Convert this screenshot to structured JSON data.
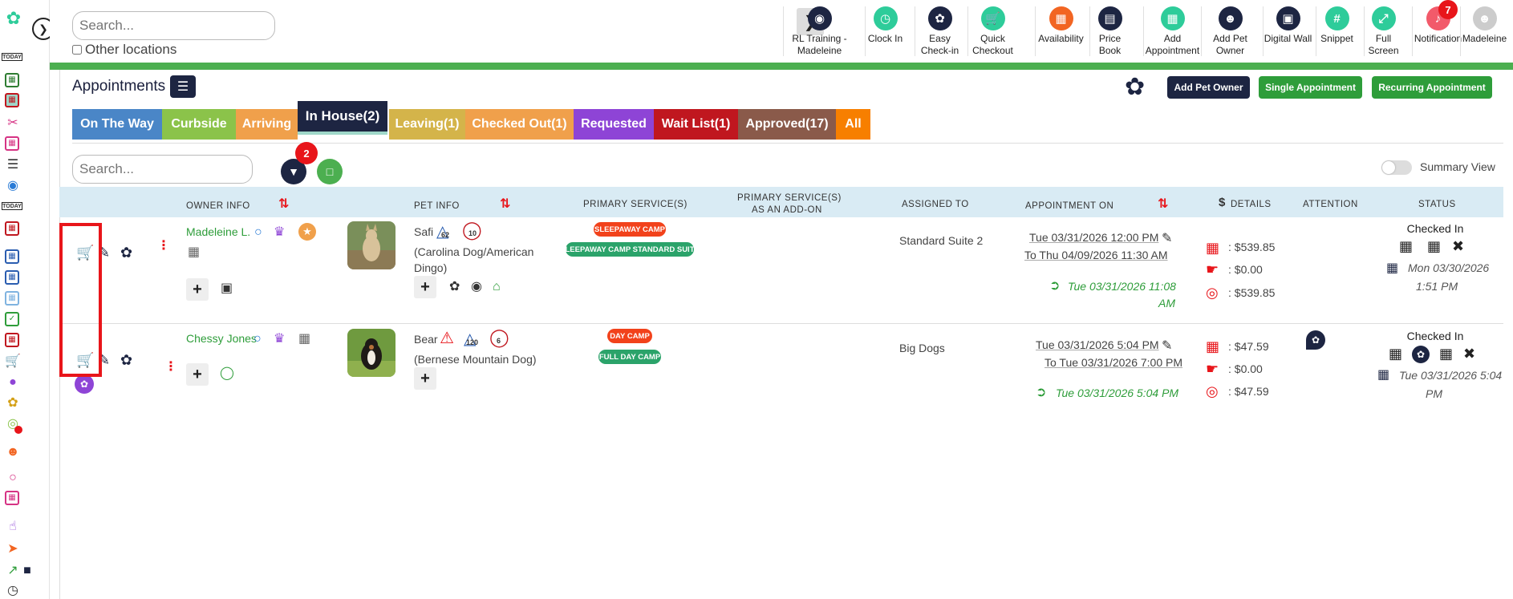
{
  "header": {
    "search_placeholder": "Search...",
    "other_locations_label": "Other locations",
    "tools": [
      {
        "label": "RL Training - Madeleine",
        "color": "#1d2542",
        "icon": "map-pin-icon"
      },
      {
        "label": "Clock In",
        "color": "#2ecc9a",
        "icon": "clock-icon"
      },
      {
        "label": "Easy Check-in",
        "color": "#1d2542",
        "icon": "paw-icon"
      },
      {
        "label": "Quick Checkout",
        "color": "#2ecc9a",
        "icon": "cart-icon"
      },
      {
        "label": "Availability",
        "color": "#f26522",
        "icon": "calendar-icon"
      },
      {
        "label": "Price Book",
        "color": "#1d2542",
        "icon": "book-icon"
      },
      {
        "label": "Add Appointment",
        "color": "#2ecc9a",
        "icon": "calendar-plus-icon"
      },
      {
        "label": "Add Pet Owner",
        "color": "#1d2542",
        "icon": "user-plus-icon"
      },
      {
        "label": "Digital Wall",
        "color": "#1d2542",
        "icon": "monitor-icon"
      },
      {
        "label": "Snippet",
        "color": "#2ecc9a",
        "icon": "hash-icon"
      },
      {
        "label": "Full Screen",
        "color": "#2ecc9a",
        "icon": "expand-icon"
      },
      {
        "label": "Notification",
        "color": "#f25a6a",
        "icon": "bell-icon"
      },
      {
        "label": "Madeleine",
        "color": "#cccccc",
        "icon": "user-icon"
      }
    ],
    "notification_count": "7"
  },
  "page": {
    "title": "Appointments",
    "add_pet_owner": "Add Pet Owner",
    "single_appointment": "Single Appointment",
    "recurring_appointment": "Recurring Appointment"
  },
  "status_tabs": [
    {
      "label": "On The Way",
      "color": "#4a86c7"
    },
    {
      "label": "Curbside",
      "color": "#8bc34a"
    },
    {
      "label": "Arriving",
      "color": "#f0a04b"
    },
    {
      "label": "In House(2)",
      "color": "#1d2542"
    },
    {
      "label": "Leaving(1)",
      "color": "#d4b44a"
    },
    {
      "label": "Checked Out(1)",
      "color": "#f0a04b"
    },
    {
      "label": "Requested",
      "color": "#8e44d6"
    },
    {
      "label": "Wait List(1)",
      "color": "#c0171f"
    },
    {
      "label": "Approved(17)",
      "color": "#8a5a4a"
    },
    {
      "label": "All",
      "color": "#f77f00"
    }
  ],
  "filters": {
    "search_placeholder": "Search...",
    "filter_count": "2",
    "summary_view_label": "Summary View"
  },
  "columns": {
    "owner_info": "OWNER INFO",
    "pet_info": "PET INFO",
    "primary_services": "PRIMARY SERVICE(S)",
    "primary_addon_1": "PRIMARY SERVICE(S)",
    "primary_addon_2": "AS AN ADD-ON",
    "assigned_to": "ASSIGNED TO",
    "appointment_on": "APPOINTMENT ON",
    "details_symbol": "$",
    "details": "DETAILS",
    "attention": "ATTENTION",
    "status": "STATUS"
  },
  "rows": [
    {
      "owner": "Madeleine L.",
      "pet_name": "Safi",
      "pet_weight": "62",
      "pet_visits": "10",
      "breed_line1": "(Carolina Dog/American",
      "breed_line2": "Dingo)",
      "service": "SLEEPAWAY CAMP",
      "service_sub": "SLEEPAWAY CAMP STANDARD SUITE",
      "assigned": "Standard Suite 2",
      "from": "Tue 03/31/2026 12:00 PM",
      "to": "To Thu 04/09/2026 11:30 AM",
      "checkin_line1": "Tue 03/31/2026 11:08",
      "checkin_line2": "AM",
      "total": ": $539.85",
      "discount": ": $0.00",
      "balance": ": $539.85",
      "status": "Checked In",
      "status_time1": "Mon 03/30/2026",
      "status_time2": "1:51 PM"
    },
    {
      "owner": "Chessy Jones",
      "pet_name": "Bear",
      "pet_weight": "120",
      "pet_visits": "6",
      "breed_line1": "(Bernese Mountain Dog)",
      "service": "DAY CAMP",
      "service_sub": "FULL DAY CAMP",
      "assigned": "Big Dogs",
      "from": "Tue 03/31/2026 5:04 PM",
      "to": "To Tue 03/31/2026 7:00 PM",
      "checkin_line1": "Tue 03/31/2026 5:04 PM",
      "total": ": $47.59",
      "discount": ": $0.00",
      "balance": ": $47.59",
      "status": "Checked In",
      "status_time1": "Tue 03/31/2026 5:04",
      "status_time2": "PM"
    }
  ]
}
